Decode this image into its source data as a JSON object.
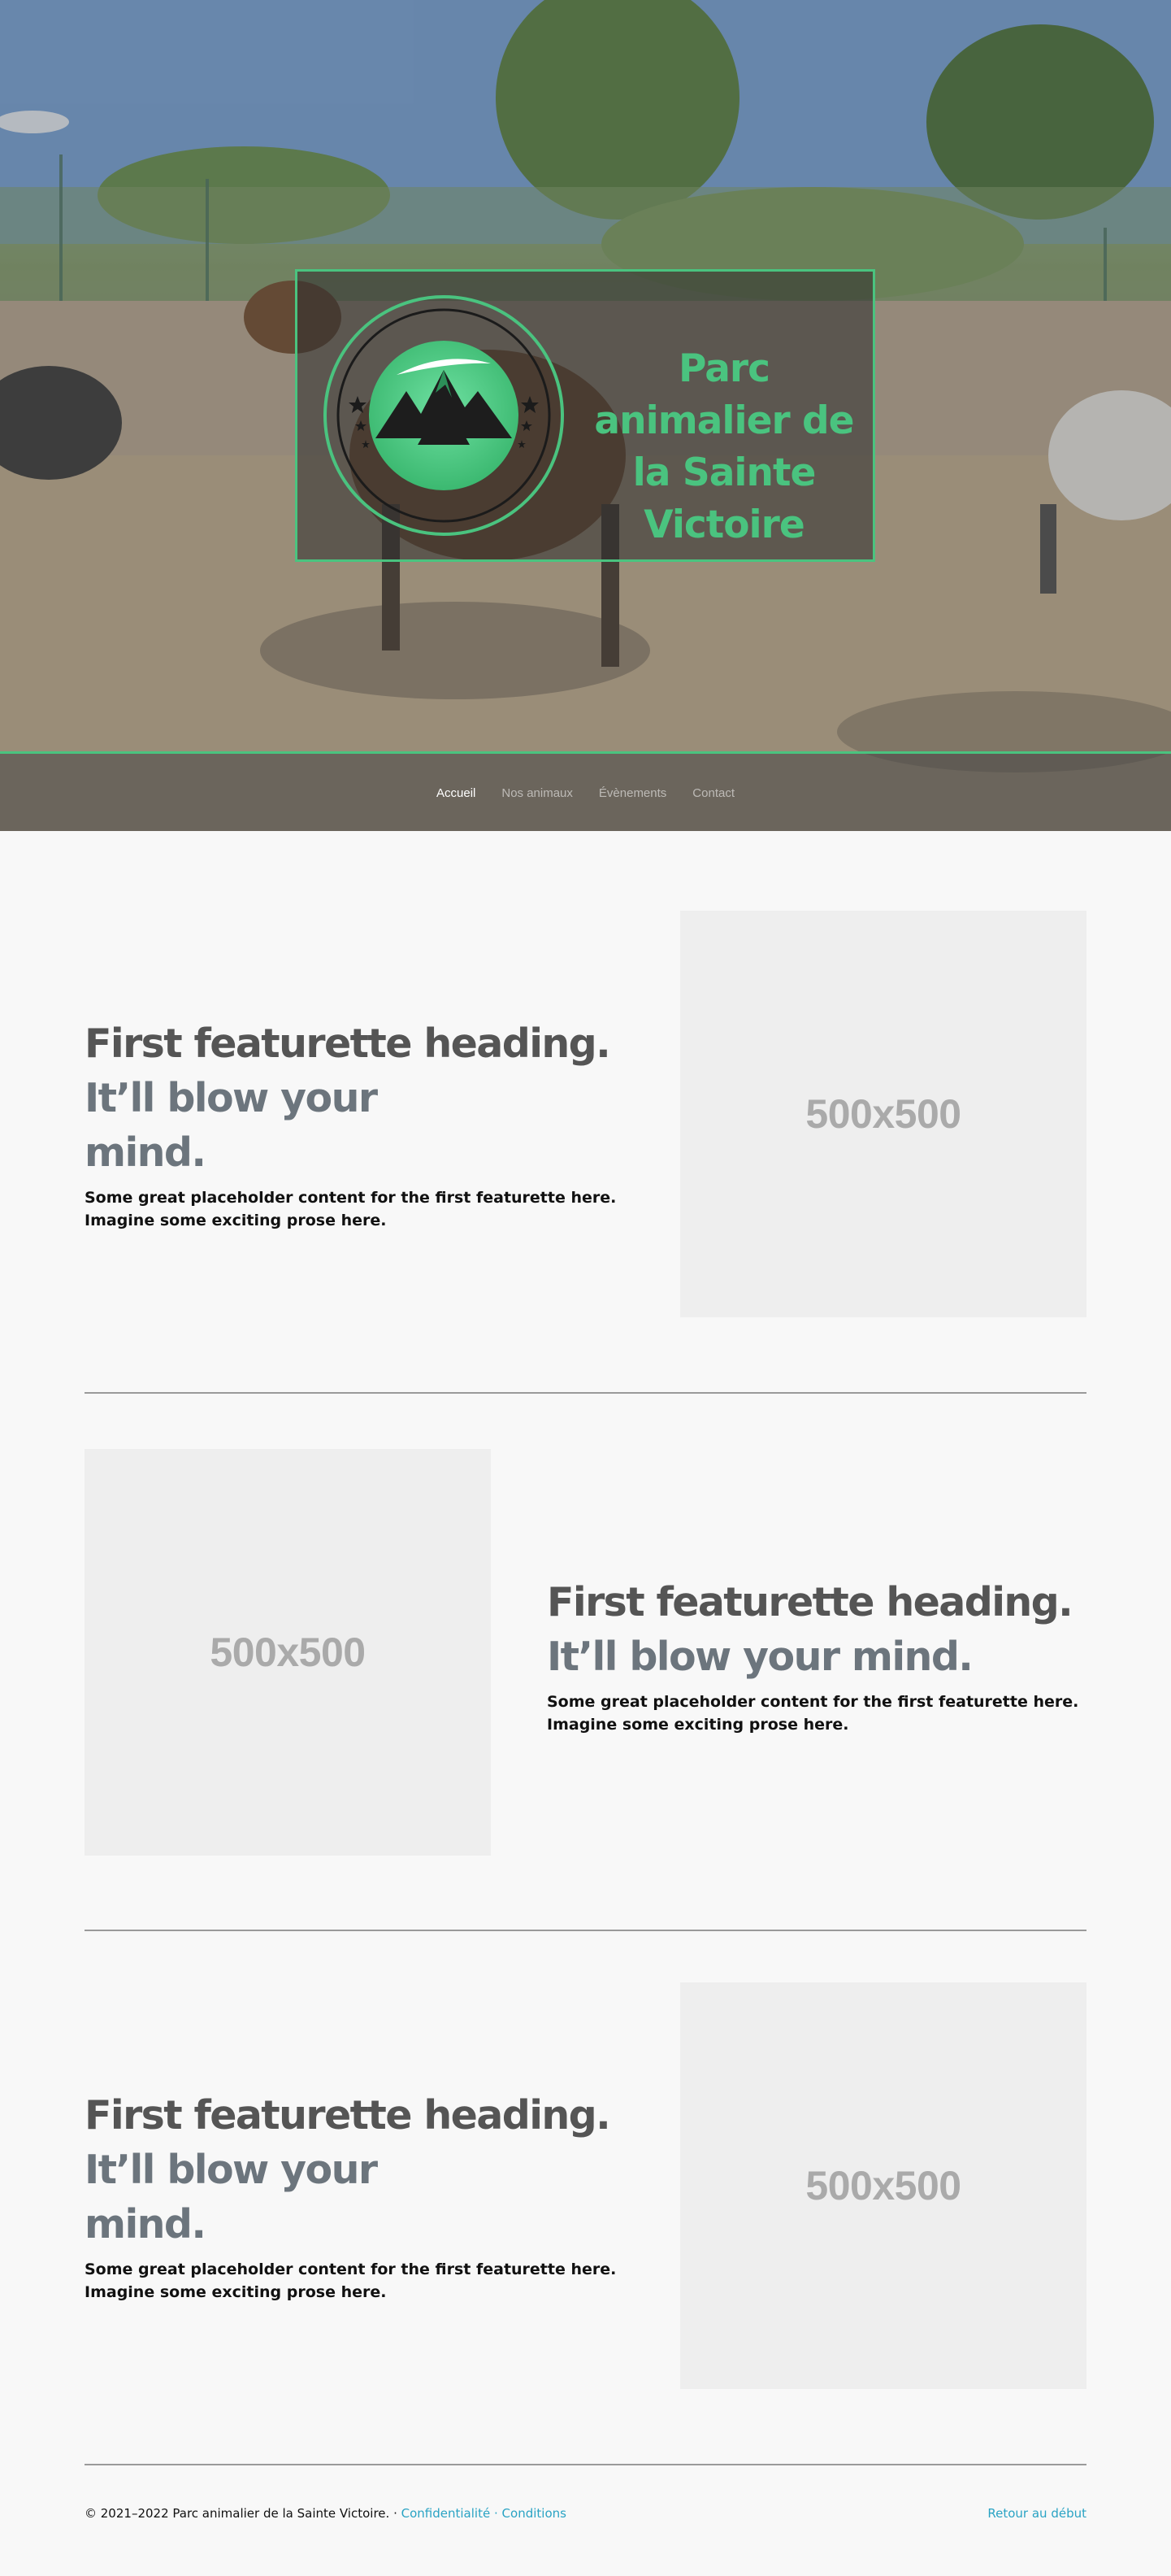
{
  "hero": {
    "brand_title": "Parc animalier de la Sainte Victoire",
    "logo_icon": "mountain-logo-icon",
    "accent_color": "#4ac37f"
  },
  "nav": {
    "items": [
      {
        "label": "Accueil",
        "active": true
      },
      {
        "label": "Nos animaux",
        "active": false
      },
      {
        "label": "Évènements",
        "active": false
      },
      {
        "label": "Contact",
        "active": false
      }
    ]
  },
  "featurettes": [
    {
      "heading": "First featurette heading.",
      "heading_muted": "It’ll blow your mind.",
      "lead": "Some great placeholder content for the first featurette here. Imagine some exciting prose here.",
      "image_label": "500x500"
    },
    {
      "heading": "First featurette heading.",
      "heading_muted": "It’ll blow your mind.",
      "lead": "Some great placeholder content for the first featurette here. Imagine some exciting prose here.",
      "image_label": "500x500"
    },
    {
      "heading": "First featurette heading.",
      "heading_muted": "It’ll blow your mind.",
      "lead": "Some great placeholder content for the first featurette here. Imagine some exciting prose here.",
      "image_label": "500x500"
    }
  ],
  "footer": {
    "copyright": "© 2021–2022 Parc animalier de la Sainte Victoire.",
    "separator": "·",
    "privacy": "Confidentialité",
    "terms": "Conditions",
    "back_to_top": "Retour au début",
    "link_color": "#2aa3c4"
  }
}
